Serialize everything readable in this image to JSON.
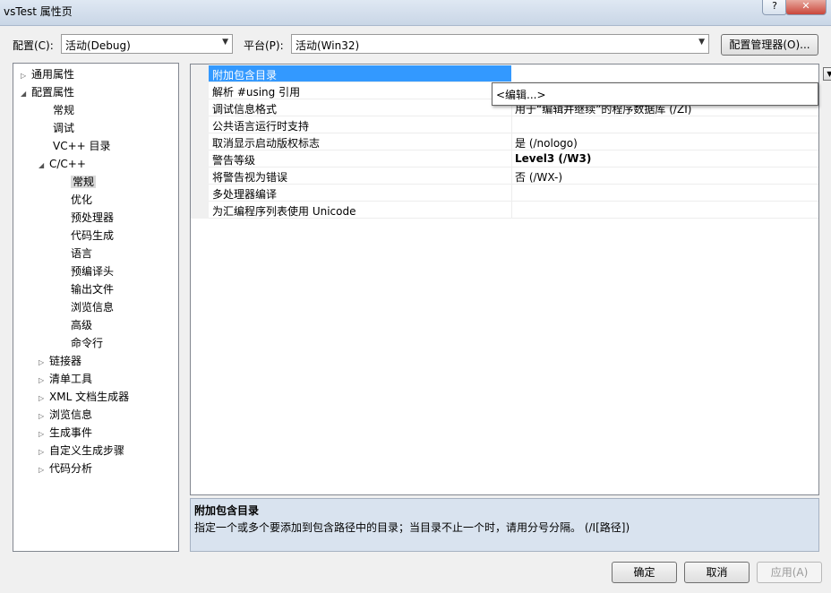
{
  "window": {
    "title": "vsTest 属性页",
    "help": "?",
    "close": "✕"
  },
  "toolbar": {
    "config_label": "配置(C):",
    "config_value": "活动(Debug)",
    "platform_label": "平台(P):",
    "platform_value": "活动(Win32)",
    "manager_button": "配置管理器(O)..."
  },
  "tree": {
    "items": [
      {
        "label": "通用属性",
        "toggle": "▷"
      },
      {
        "label": "配置属性",
        "toggle": "◢"
      },
      {
        "label": "常规",
        "toggle": ""
      },
      {
        "label": "调试",
        "toggle": ""
      },
      {
        "label": "VC++ 目录",
        "toggle": ""
      },
      {
        "label": "C/C++",
        "toggle": "◢"
      },
      {
        "label": "常规",
        "toggle": ""
      },
      {
        "label": "优化",
        "toggle": ""
      },
      {
        "label": "预处理器",
        "toggle": ""
      },
      {
        "label": "代码生成",
        "toggle": ""
      },
      {
        "label": "语言",
        "toggle": ""
      },
      {
        "label": "预编译头",
        "toggle": ""
      },
      {
        "label": "输出文件",
        "toggle": ""
      },
      {
        "label": "浏览信息",
        "toggle": ""
      },
      {
        "label": "高级",
        "toggle": ""
      },
      {
        "label": "命令行",
        "toggle": ""
      },
      {
        "label": "链接器",
        "toggle": "▷"
      },
      {
        "label": "清单工具",
        "toggle": "▷"
      },
      {
        "label": "XML 文档生成器",
        "toggle": "▷"
      },
      {
        "label": "浏览信息",
        "toggle": "▷"
      },
      {
        "label": "生成事件",
        "toggle": "▷"
      },
      {
        "label": "自定义生成步骤",
        "toggle": "▷"
      },
      {
        "label": "代码分析",
        "toggle": "▷"
      }
    ]
  },
  "properties": {
    "rows": [
      {
        "name": "附加包含目录",
        "value": ""
      },
      {
        "name": "解析 #using 引用",
        "value": ""
      },
      {
        "name": "调试信息格式",
        "value": "用于“编辑并继续”的程序数据库 (/ZI)"
      },
      {
        "name": "公共语言运行时支持",
        "value": ""
      },
      {
        "name": "取消显示启动版权标志",
        "value": "是 (/nologo)"
      },
      {
        "name": "警告等级",
        "value": "Level3 (/W3)"
      },
      {
        "name": "将警告视为错误",
        "value": "否 (/WX-)"
      },
      {
        "name": "多处理器编译",
        "value": ""
      },
      {
        "name": "为汇编程序列表使用 Unicode",
        "value": ""
      }
    ],
    "dropdown_arrow": "▼",
    "dropdown_option": "<编辑...>"
  },
  "description": {
    "title": "附加包含目录",
    "text": "指定一个或多个要添加到包含路径中的目录；当目录不止一个时，请用分号分隔。     (/I[路径])"
  },
  "buttons": {
    "ok": "确定",
    "cancel": "取消",
    "apply": "应用(A)"
  }
}
